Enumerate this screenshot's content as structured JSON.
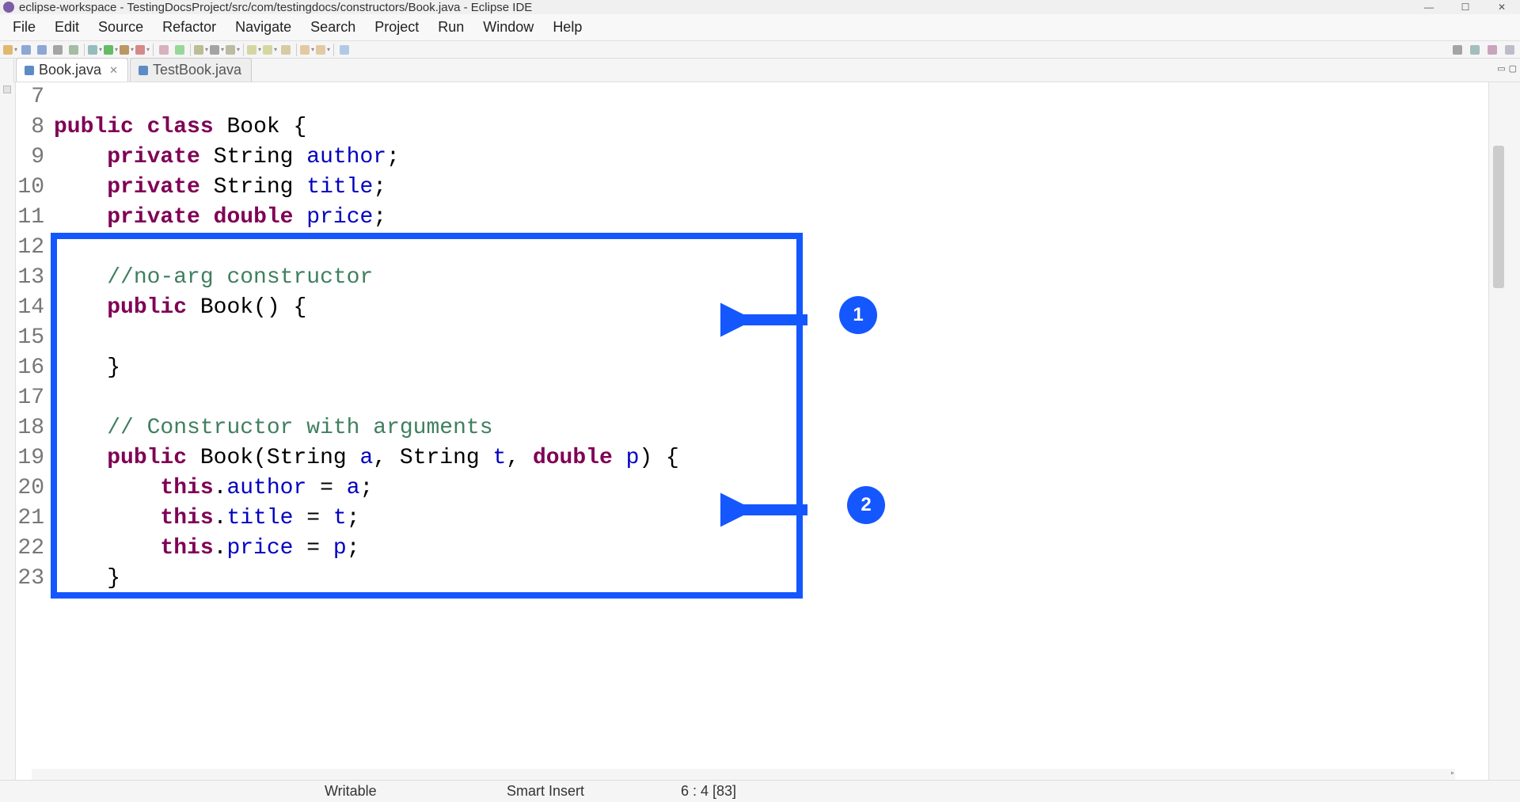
{
  "window": {
    "title": "eclipse-workspace - TestingDocsProject/src/com/testingdocs/constructors/Book.java - Eclipse IDE"
  },
  "menu": [
    "File",
    "Edit",
    "Source",
    "Refactor",
    "Navigate",
    "Search",
    "Project",
    "Run",
    "Window",
    "Help"
  ],
  "tabs": [
    {
      "label": "Book.java",
      "active": true,
      "dirty": false
    },
    {
      "label": "TestBook.java",
      "active": false,
      "dirty": false
    }
  ],
  "code": {
    "first_line_no": 7,
    "lines": [
      {
        "n": 7,
        "tokens": []
      },
      {
        "n": 8,
        "tokens": [
          {
            "t": "public",
            "c": "kw"
          },
          {
            "t": " "
          },
          {
            "t": "class",
            "c": "kw"
          },
          {
            "t": " Book {"
          }
        ]
      },
      {
        "n": 9,
        "tokens": [
          {
            "t": "    "
          },
          {
            "t": "private",
            "c": "kw"
          },
          {
            "t": " String "
          },
          {
            "t": "author",
            "c": "field"
          },
          {
            "t": ";"
          }
        ]
      },
      {
        "n": 10,
        "tokens": [
          {
            "t": "    "
          },
          {
            "t": "private",
            "c": "kw"
          },
          {
            "t": " String "
          },
          {
            "t": "title",
            "c": "field"
          },
          {
            "t": ";"
          }
        ]
      },
      {
        "n": 11,
        "tokens": [
          {
            "t": "    "
          },
          {
            "t": "private",
            "c": "kw"
          },
          {
            "t": " "
          },
          {
            "t": "double",
            "c": "kw"
          },
          {
            "t": " "
          },
          {
            "t": "price",
            "c": "field"
          },
          {
            "t": ";"
          }
        ]
      },
      {
        "n": 12,
        "tokens": []
      },
      {
        "n": 13,
        "tokens": [
          {
            "t": "    "
          },
          {
            "t": "//no-arg constructor",
            "c": "comment"
          }
        ]
      },
      {
        "n": 14,
        "tokens": [
          {
            "t": "    "
          },
          {
            "t": "public",
            "c": "kw"
          },
          {
            "t": " Book() {"
          }
        ]
      },
      {
        "n": 15,
        "tokens": []
      },
      {
        "n": 16,
        "tokens": [
          {
            "t": "    }"
          }
        ]
      },
      {
        "n": 17,
        "tokens": []
      },
      {
        "n": 18,
        "tokens": [
          {
            "t": "    "
          },
          {
            "t": "// Constructor with arguments",
            "c": "comment"
          }
        ]
      },
      {
        "n": 19,
        "tokens": [
          {
            "t": "    "
          },
          {
            "t": "public",
            "c": "kw"
          },
          {
            "t": " Book(String "
          },
          {
            "t": "a",
            "c": "field"
          },
          {
            "t": ", String "
          },
          {
            "t": "t",
            "c": "field"
          },
          {
            "t": ", "
          },
          {
            "t": "double",
            "c": "kw"
          },
          {
            "t": " "
          },
          {
            "t": "p",
            "c": "field"
          },
          {
            "t": ") {"
          }
        ]
      },
      {
        "n": 20,
        "tokens": [
          {
            "t": "        "
          },
          {
            "t": "this",
            "c": "kw"
          },
          {
            "t": "."
          },
          {
            "t": "author",
            "c": "field"
          },
          {
            "t": " = "
          },
          {
            "t": "a",
            "c": "field"
          },
          {
            "t": ";"
          }
        ]
      },
      {
        "n": 21,
        "tokens": [
          {
            "t": "        "
          },
          {
            "t": "this",
            "c": "kw"
          },
          {
            "t": "."
          },
          {
            "t": "title",
            "c": "field"
          },
          {
            "t": " = "
          },
          {
            "t": "t",
            "c": "field"
          },
          {
            "t": ";"
          }
        ]
      },
      {
        "n": 22,
        "tokens": [
          {
            "t": "        "
          },
          {
            "t": "this",
            "c": "kw"
          },
          {
            "t": "."
          },
          {
            "t": "price",
            "c": "field"
          },
          {
            "t": " = "
          },
          {
            "t": "p",
            "c": "field"
          },
          {
            "t": ";"
          }
        ]
      },
      {
        "n": 23,
        "tokens": [
          {
            "t": "    }"
          }
        ]
      }
    ]
  },
  "annotations": {
    "badge1": "1",
    "badge2": "2"
  },
  "status": {
    "writable": "Writable",
    "insert_mode": "Smart Insert",
    "cursor": "6 : 4 [83]"
  },
  "toolbar_icons": [
    "new-drop",
    "save",
    "save-all",
    "print",
    "build",
    "sep",
    "debug-drop",
    "run-green-drop",
    "ext-tools-drop",
    "coverage-drop",
    "sep",
    "new-pkg",
    "new-class",
    "sep",
    "open-type-drop",
    "search-drop",
    "annotate-drop",
    "sep",
    "back-drop",
    "fwd-drop",
    "last-edit",
    "sep",
    "nav-back-drop",
    "nav-fwd-drop",
    "sep",
    "pin"
  ],
  "toolbar_right_icons": [
    "search",
    "open-perspective",
    "java-perspective",
    "debug-perspective"
  ]
}
